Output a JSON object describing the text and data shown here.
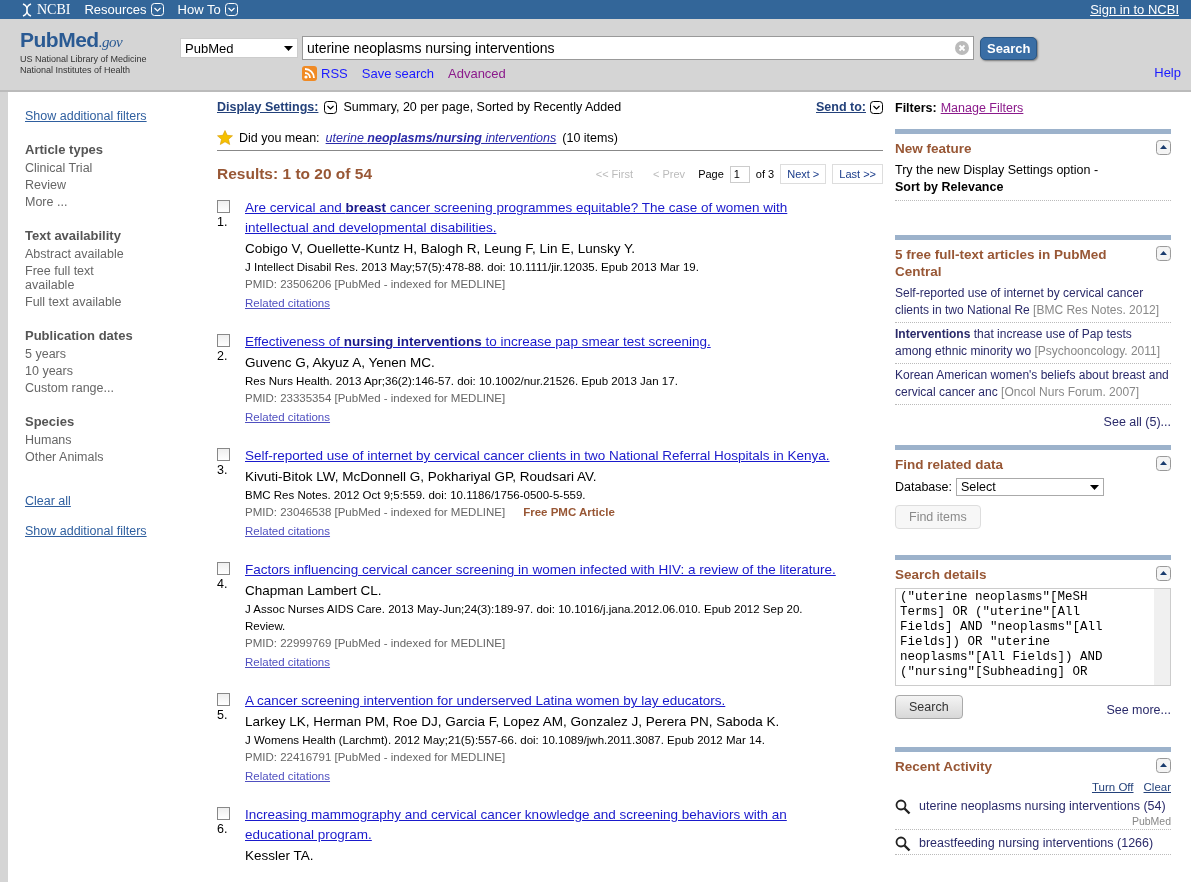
{
  "top_bar": {
    "brand": "NCBI",
    "menus": [
      "Resources",
      "How To"
    ],
    "sign_in": "Sign in to NCBI"
  },
  "header": {
    "logo": "PubMed",
    "logo_suffix": ".gov",
    "org_lines": [
      "US National Library of Medicine",
      "National Institutes of Health"
    ],
    "database": "PubMed",
    "query": "uterine neoplasms nursing interventions",
    "search_button": "Search",
    "links": [
      {
        "label": "RSS",
        "kind": "rss",
        "visited": false
      },
      {
        "label": "Save search",
        "kind": "link",
        "visited": false
      },
      {
        "label": "Advanced",
        "kind": "link",
        "visited": true
      }
    ],
    "help": "Help"
  },
  "sidebar": {
    "top_link": "Show additional filters",
    "groups": [
      {
        "title": "Article types",
        "items": [
          "Clinical Trial",
          "Review",
          "More ..."
        ]
      },
      {
        "title": "Text availability",
        "items": [
          "Abstract available",
          "Free full text available",
          "Full text available"
        ]
      },
      {
        "title": "Publication dates",
        "items": [
          "5 years",
          "10 years",
          "Custom range..."
        ]
      },
      {
        "title": "Species",
        "items": [
          "Humans",
          "Other Animals"
        ]
      }
    ],
    "clear": "Clear all",
    "bottom_link": "Show additional filters"
  },
  "results": {
    "display_label": "Display Settings:",
    "display_summary": "Summary, 20 per page, Sorted by Recently Added",
    "send_to": "Send to:",
    "did_you_mean_label": "Did you mean:",
    "suggestion": "uterine **neoplasms/nursing** interventions",
    "suggestion_count": "(10 items)",
    "count": "Results: 1 to 20 of 54",
    "pager": {
      "buttons_before": [
        {
          "label": "<< First",
          "disabled": true
        },
        {
          "label": "< Prev",
          "disabled": true
        }
      ],
      "page_label": "Page",
      "page": "1",
      "of": "of 3",
      "buttons_after": [
        {
          "label": "Next >",
          "disabled": false
        },
        {
          "label": "Last >>",
          "disabled": false
        }
      ]
    },
    "items": [
      {
        "number": "1.",
        "checked": false,
        "title": "Are cervical and **breast** cancer screening programmes equitable? The case of women with intellectual and developmental disabilities.",
        "authors": "Cobigo V, Ouellette-Kuntz H, Balogh R, Leung F, Lin E, Lunsky Y.",
        "citation": "J Intellect Disabil Res. 2013 May;57(5):478-88. doi: 10.1111/jir.12035. Epub 2013 Mar 19.",
        "pmid": "PMID: 23506206 [PubMed - indexed for MEDLINE]",
        "related": "Related citations"
      },
      {
        "number": "2.",
        "checked": false,
        "title": "Effectiveness of **nursing interventions** to increase pap smear test screening.",
        "authors": "Guvenc G, Akyuz A, Yenen MC.",
        "citation": "Res Nurs Health. 2013 Apr;36(2):146-57. doi: 10.1002/nur.21526. Epub 2013 Jan 17.",
        "pmid": "PMID: 23335354 [PubMed - indexed for MEDLINE]",
        "related": "Related citations"
      },
      {
        "number": "3.",
        "checked": false,
        "title": "Self-reported use of internet by cervical cancer clients in two National Referral Hospitals in Kenya.",
        "authors": "Kivuti-Bitok LW, McDonnell G, Pokhariyal GP, Roudsari AV.",
        "citation": "BMC Res Notes. 2012 Oct 9;5:559. doi: 10.1186/1756-0500-5-559.",
        "pmid": "PMID: 23046538 [PubMed - indexed for MEDLINE]",
        "free": "Free PMC Article",
        "related": "Related citations"
      },
      {
        "number": "4.",
        "checked": false,
        "title": "Factors influencing cervical cancer screening in women infected with HIV: a review of the literature.",
        "authors": "Chapman Lambert CL.",
        "citation": "J Assoc Nurses AIDS Care. 2013 May-Jun;24(3):189-97. doi: 10.1016/j.jana.2012.06.010. Epub 2012 Sep 20.",
        "note": "Review.",
        "pmid": "PMID: 22999769 [PubMed - indexed for MEDLINE]",
        "related": "Related citations"
      },
      {
        "number": "5.",
        "checked": false,
        "title": "A cancer screening intervention for underserved Latina women by lay educators.",
        "authors": "Larkey LK, Herman PM, Roe DJ, Garcia F, Lopez AM, Gonzalez J, Perera PN, Saboda K.",
        "citation": "J Womens Health (Larchmt). 2012 May;21(5):557-66. doi: 10.1089/jwh.2011.3087. Epub 2012 Mar 14.",
        "pmid": "PMID: 22416791 [PubMed - indexed for MEDLINE]",
        "related": "Related citations"
      },
      {
        "number": "6.",
        "checked": false,
        "title": "Increasing mammography and cervical cancer knowledge and screening behaviors with an educational program.",
        "authors": "Kessler TA."
      }
    ]
  },
  "right": {
    "filters_label": "Filters:",
    "manage": "Manage Filters",
    "manage_visited": true,
    "panels": [
      {
        "kind": "feature",
        "title": "New feature",
        "text": "Try the new Display Settings option -",
        "bold_text": "Sort by Relevance"
      },
      {
        "kind": "articles",
        "title": "5 free full-text articles in PubMed Central",
        "articles": [
          {
            "title": "Self-reported use of internet by cervical cancer clients in two National Re",
            "source": "[BMC Res Notes. 2012]"
          },
          {
            "title": "**Interventions** that increase use of Pap tests among ethnic minority wo",
            "source": "[Psychooncology. 2011]"
          },
          {
            "title": "Korean American women's beliefs about breast and cervical cancer anc",
            "source": "[Oncol Nurs Forum. 2007]"
          }
        ],
        "see_all": "See all (5)..."
      },
      {
        "kind": "related",
        "title": "Find related data",
        "database_label": "Database:",
        "database": "Select",
        "button": "Find items",
        "button_disabled": true
      },
      {
        "kind": "details",
        "title": "Search details",
        "query_text": "(\"uterine neoplasms\"[MeSH Terms] OR (\"uterine\"[All Fields] AND \"neoplasms\"[All Fields]) OR \"uterine neoplasms\"[All Fields]) AND (\"nursing\"[Subheading] OR",
        "button": "Search",
        "see_more": "See more..."
      },
      {
        "kind": "activity",
        "title": "Recent Activity",
        "actions": [
          "Turn Off",
          "Clear"
        ],
        "entries": [
          {
            "text": "uterine neoplasms nursing interventions (54)",
            "db": "PubMed"
          },
          {
            "text": "breastfeeding nursing interventions (1266)"
          }
        ]
      }
    ]
  }
}
